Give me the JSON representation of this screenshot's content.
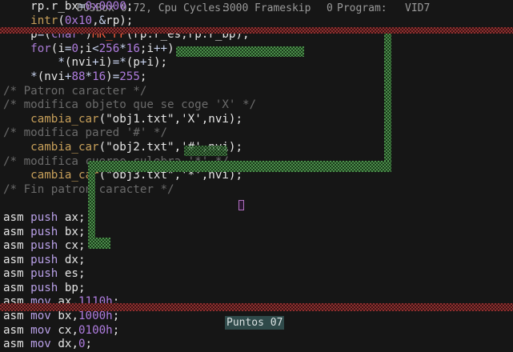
{
  "window": {
    "title_left": "DOSBox 0.72, Cpu Cycles:",
    "cycles_value": "3000",
    "frameskip_label": "Frameskip",
    "frameskip_value": "0",
    "program_label": "Program:",
    "program_value": "VID7"
  },
  "editor": {
    "lines": [
      "    rp.r_bx=0x0000;",
      "    intr(0x10,&rp);",
      "    p=(char*)MK_FP(rp.r_es,rp.r_bp);",
      "    for(i=0;i<256*16;i++)",
      "        *(nvi+i)=*(p+i);",
      "    *(nvi+88*16)=255;",
      "/* Patron caracter */",
      "/* modifica objeto que se coge 'X' */",
      "    cambia_car(\"obj1.txt\",'X',nvi);",
      "/* modifica pared '#' */",
      "    cambia_car(\"obj2.txt\",'#',nvi);",
      "/* modifica cuerpo culebra '*' */",
      "    cambia_car(\"obj3.txt\",'*',nvi);",
      "/* Fin patron caracter */",
      "",
      "asm push ax;",
      "asm push bx;",
      "asm push cx;",
      "asm push dx;",
      "asm push es;",
      "asm push bp;",
      "asm mov ax,1110h;",
      "asm mov bx,1000h;",
      "asm mov cx,0100h;",
      "asm mov dx,0;"
    ]
  },
  "game": {
    "score_label": "Puntos",
    "score_value": "07",
    "colors": {
      "wall": "#c84646",
      "snake": "#6ec86e",
      "food": "#b070c0",
      "score_bg": "#2f4a4a"
    }
  }
}
